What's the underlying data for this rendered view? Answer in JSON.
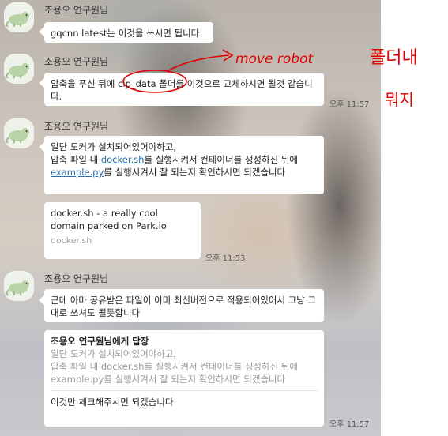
{
  "sender_name": "조용오 연구원님",
  "messages": [
    {
      "text": "gqcnn latest는 이것을 쓰시면 됩니다"
    },
    {
      "text_before": "압축을 푸신 뒤에 ",
      "highlight": "cip_data",
      "text_after": " 폴더를 이것으로 교체하시면 될것 같습니다.",
      "time": "오후 11:57"
    },
    {
      "line1": "일단 도커가 설치되어있어야하고,",
      "line2_before": "압축 파일 내 ",
      "link1": "docker.sh",
      "line2_after": "를 실행시켜서 컨테이너를 생성하신 뒤에",
      "link2": "example.py",
      "line3_after": "를 실행시켜서 잘 되는지 확인하시면 되겠습니다"
    },
    {
      "preview_title": "docker.sh - a really cool domain parked on Park.io",
      "preview_domain": "docker.sh",
      "time": "오후 11:53"
    },
    {
      "text": "근데 아마 공유받은 파일이 이미 최신버전으로 적용되어있어서 그냥 그대로 쓰셔도 될듯합니다"
    },
    {
      "reply_to": "조용오 연구원님에게 답장",
      "quote_line1": "일단 도커가 설치되어있어야하고,",
      "quote_line2": "압축 파일 내 docker.sh를 실행시켜서 컨테이너를 생성하신 뒤에",
      "quote_line3": "example.py를 실행시켜서 잘 되는지 확인하시면 되겠습니다",
      "text": "이것만 체크해주시면 되겠습니다",
      "time": "오후 11:57"
    }
  ],
  "annotation": {
    "arrow_text": "move robot",
    "korean_text": "폴더내",
    "korean_text2": "뭐지",
    "color": "#e00000"
  },
  "colors": {
    "bubble": "#ffffff",
    "link": "#2b6cb0",
    "ink": "#e00000"
  }
}
